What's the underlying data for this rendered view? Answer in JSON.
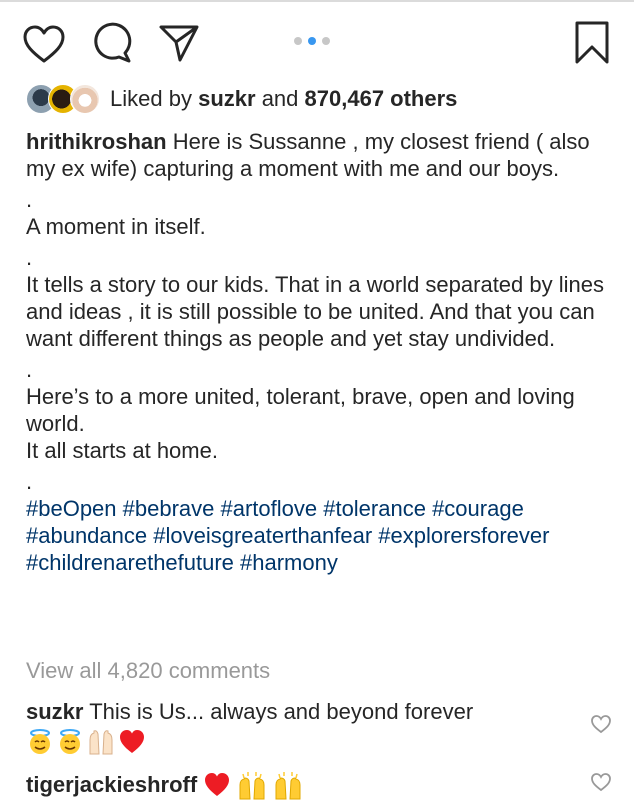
{
  "likes": {
    "prefix": "Liked by",
    "user": "suzkr",
    "connector": "and",
    "count": "870,467 others"
  },
  "caption": {
    "username": "hrithikroshan",
    "line1": "Here is Sussanne , my closest friend ( also my ex wife) capturing a moment with me and our boys.",
    "sep": ".",
    "p2": "A moment in itself.",
    "p3": "It tells a story to our kids. That in a world separated by lines and ideas , it is still possible to be united. And that you can want different things as people and yet stay undivided.",
    "p4a": "Here’s to a more united, tolerant, brave, open and loving world.",
    "p4b": "It all starts at home.",
    "hashtags": "#beOpen #bebrave #artoflove #tolerance #courage #abundance #loveisgreaterthanfear #explorersforever #childrenarethefuture #harmony"
  },
  "view_all_comments": "View all 4,820 comments",
  "comments": [
    {
      "username": "suzkr",
      "text": "This is Us... always and beyond forever",
      "emojis": [
        "halo-face",
        "halo-face",
        "raised-hands",
        "red-heart"
      ]
    },
    {
      "username": "tigerjackieshroff",
      "text": "",
      "emojis": [
        "red-heart",
        "celebrating-hands",
        "celebrating-hands"
      ]
    }
  ],
  "colors": {
    "text": "#262626",
    "hashtag": "#003569",
    "muted": "#999999",
    "active_dot": "#3897f0",
    "heart": "#ed1c24"
  }
}
